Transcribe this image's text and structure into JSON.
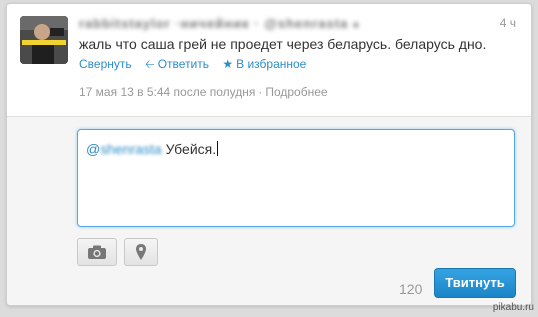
{
  "tweet": {
    "author": "rabbitstaylor ·ничейник · @shenrasta",
    "time": "4 ч",
    "text": "жаль что саша грей не проедет через беларусь. беларусь дно.",
    "actions": {
      "collapse": "Свернуть",
      "reply": "Ответить",
      "favorite": "В избранное"
    },
    "timestamp": "17 мая 13 в 5:44 после полудня",
    "details_link": "Подробнее",
    "separator": "·"
  },
  "reply": {
    "mention_at": "@",
    "mention_name": "shenrasta",
    "typed_text": " Убейся.",
    "char_count": "120",
    "submit_label": "Твитнуть"
  },
  "watermark": "pikabu.ru",
  "colors": {
    "link": "#2f8cc7",
    "button": "#2a9ad9",
    "focus_border": "#56a8e0"
  }
}
